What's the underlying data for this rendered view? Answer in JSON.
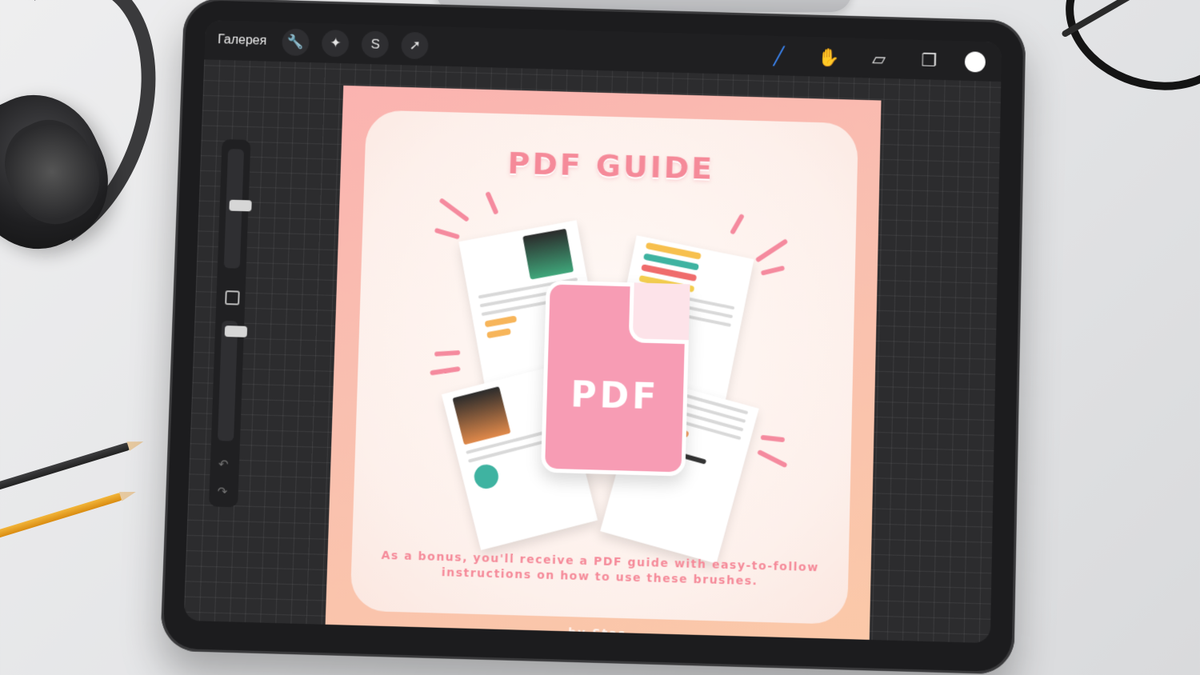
{
  "topbar": {
    "gallery_label": "Галерея",
    "left_tools": [
      {
        "icon": "wrench-icon",
        "glyph": "🔧"
      },
      {
        "icon": "magic-wand-icon",
        "glyph": "✦"
      },
      {
        "icon": "selection-icon",
        "glyph": "S"
      },
      {
        "icon": "transform-arrow-icon",
        "glyph": "➚"
      }
    ],
    "right_tools": [
      {
        "icon": "brush-icon",
        "glyph": "╱"
      },
      {
        "icon": "smudge-icon",
        "glyph": "✋"
      },
      {
        "icon": "eraser-icon",
        "glyph": "▱"
      },
      {
        "icon": "layers-icon",
        "glyph": "❐"
      }
    ],
    "active_tool": "brush-icon",
    "active_color": "#ffffff",
    "accent_color": "#3d8bff"
  },
  "sidebar": {
    "undo_glyph": "↶",
    "redo_glyph": "↷"
  },
  "artwork": {
    "title": "PDF GUIDE",
    "pdf_label": "PDF",
    "bonus_text": "As a bonus, you'll receive a PDF guide with easy-to-follow instructions on how to use these brushes.",
    "author": "by Stas",
    "accent_color": "#f58a99",
    "background_color": "#fbb3b0"
  }
}
